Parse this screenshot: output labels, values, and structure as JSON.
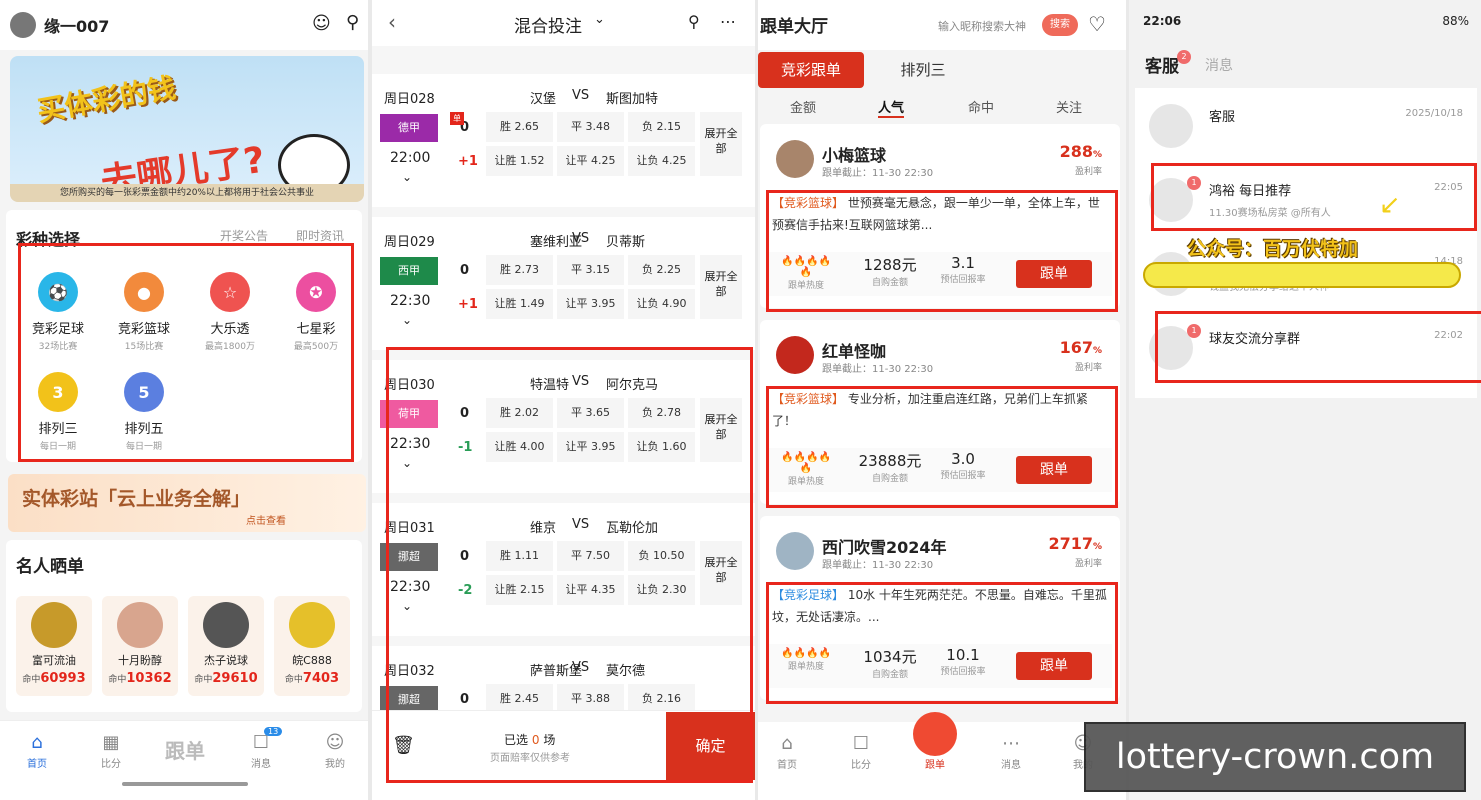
{
  "p1": {
    "username": "缘一007",
    "banner": {
      "line1": "买体彩的钱",
      "line2": "去哪儿了?",
      "footer": "您所购买的每一张彩票金额中约20%以上都将用于社会公共事业"
    },
    "section_title": "彩种选择",
    "links": [
      "开奖公告",
      "即时资讯"
    ],
    "lotteries": [
      {
        "name": "竞彩足球",
        "sub": "32场比赛",
        "icon": "soccer-icon",
        "color": "#29b6e8"
      },
      {
        "name": "竞彩篮球",
        "sub": "15场比赛",
        "icon": "basketball-icon",
        "color": "#f28a3c"
      },
      {
        "name": "大乐透",
        "sub": "最高1800万",
        "icon": "star-icon",
        "color": "#ef5350"
      },
      {
        "name": "七星彩",
        "sub": "最高500万",
        "icon": "seven-star-icon",
        "color": "#ec4fa0"
      },
      {
        "name": "排列三",
        "sub": "每日一期",
        "icon": "three-icon",
        "color": "#f2c21a"
      },
      {
        "name": "排列五",
        "sub": "每日一期",
        "icon": "five-icon",
        "color": "#5b7fe0"
      }
    ],
    "promo": {
      "title": "实体彩站「云上业务全解」",
      "link": "点击查看"
    },
    "famous_title": "名人晒单",
    "famous": [
      {
        "name": "富可流油",
        "hit_label": "命中",
        "hit": "60993"
      },
      {
        "name": "十月盼醇",
        "hit_label": "命中",
        "hit": "10362"
      },
      {
        "name": "杰子说球",
        "hit_label": "命中",
        "hit": "29610"
      },
      {
        "name": "皖C888",
        "hit_label": "命中",
        "hit": "7403"
      }
    ],
    "tabs": [
      {
        "label": "首页",
        "icon": "home-icon"
      },
      {
        "label": "比分",
        "icon": "score-icon"
      },
      {
        "label": "跟单",
        "icon": "follow-icon"
      },
      {
        "label": "消息",
        "icon": "message-icon",
        "badge": "13"
      },
      {
        "label": "我的",
        "icon": "profile-icon"
      }
    ]
  },
  "p2": {
    "title": "混合投注",
    "matches": [
      {
        "day": "周日028",
        "home": "汉堡",
        "vs": "VS",
        "away": "斯图加特",
        "league": "德甲",
        "league_color": "#9b2aa8",
        "time": "22:00",
        "h0": "0",
        "h1": "+1",
        "row1": [
          "胜 2.65",
          "平 3.48",
          "负 2.15"
        ],
        "row2": [
          "让胜 1.52",
          "让平 4.25",
          "让负 4.25"
        ],
        "single": "单"
      },
      {
        "day": "周日029",
        "home": "塞维利亚",
        "vs": "VS",
        "away": "贝蒂斯",
        "league": "西甲",
        "league_color": "#1e8a4a",
        "time": "22:30",
        "h0": "0",
        "h1": "+1",
        "row1": [
          "胜 2.73",
          "平 3.15",
          "负 2.25"
        ],
        "row2": [
          "让胜 1.49",
          "让平 3.95",
          "让负 4.90"
        ]
      },
      {
        "day": "周日030",
        "home": "特温特",
        "vs": "VS",
        "away": "阿尔克马",
        "league": "荷甲",
        "league_color": "#ef5aa0",
        "time": "22:30",
        "h0": "0",
        "h1": "-1",
        "row1": [
          "胜 2.02",
          "平 3.65",
          "负 2.78"
        ],
        "row2": [
          "让胜 4.00",
          "让平 3.95",
          "让负 1.60"
        ]
      },
      {
        "day": "周日031",
        "home": "维京",
        "vs": "VS",
        "away": "瓦勒伦加",
        "league": "挪超",
        "league_color": "#666666",
        "time": "22:30",
        "h0": "0",
        "h1": "-2",
        "row1": [
          "胜 1.11",
          "平 7.50",
          "负 10.50"
        ],
        "row2": [
          "让胜 2.15",
          "让平 4.35",
          "让负 2.30"
        ]
      },
      {
        "day": "周日032",
        "home": "萨普斯堡",
        "vs": "VS",
        "away": "莫尔德",
        "league": "挪超",
        "league_color": "#666666",
        "time": "",
        "h0": "0",
        "h1": "",
        "row1": [
          "胜 2.45",
          "平 3.88",
          "负 2.16"
        ],
        "row2": [
          "",
          "",
          ""
        ]
      }
    ],
    "expand": "展开全部",
    "footer": {
      "selected_prefix": "已选",
      "selected_count": "0",
      "selected_suffix": "场",
      "note": "页面赔率仅供参考",
      "confirm": "确定"
    }
  },
  "p3": {
    "title": "跟单大厅",
    "search_placeholder": "输入昵称搜索大神",
    "search_btn": "搜索",
    "tabs": [
      "竞彩跟单",
      "排列三"
    ],
    "subtabs": [
      "金额",
      "人气",
      "命中",
      "关注"
    ],
    "cards": [
      {
        "name": "小梅篮球",
        "deadline": "跟单截止：11-30 22:30",
        "rate": "288",
        "rate_unit": "%",
        "rate_label": "盈利率",
        "tag": "【竞彩篮球】",
        "tag_color": "orange",
        "text": "世预赛毫无悬念，跟一单少一单，全体上车，世预赛信手拈来!互联网篮球第...",
        "heat": "🔥🔥🔥🔥🔥",
        "heat_label": "跟单热度",
        "amount": "1288元",
        "amount_label": "自购金额",
        "ret": "3.1",
        "ret_label": "预估回报率",
        "btn": "跟单",
        "avatar_color": "#a8856b"
      },
      {
        "name": "红单怪咖",
        "deadline": "跟单截止：11-30 22:30",
        "rate": "167",
        "rate_unit": "%",
        "rate_label": "盈利率",
        "tag": "【竞彩篮球】",
        "tag_color": "orange",
        "text": "专业分析，加注重启连红路，兄弟们上车抓紧了！",
        "heat": "🔥🔥🔥🔥🔥",
        "heat_label": "跟单热度",
        "amount": "23888元",
        "amount_label": "自购金额",
        "ret": "3.0",
        "ret_label": "预估回报率",
        "btn": "跟单",
        "avatar_color": "#c3281d"
      },
      {
        "name": "西门吹雪2024年",
        "deadline": "跟单截止：11-30 22:30",
        "rate": "2717",
        "rate_unit": "%",
        "rate_label": "盈利率",
        "tag": "【竞彩足球】",
        "tag_color": "blue",
        "text": "10水 十年生死两茫茫。不思量。自难忘。千里孤坟，无处话凄凉。...",
        "heat": "🔥🔥🔥🔥",
        "heat_label": "跟单热度",
        "amount": "1034元",
        "amount_label": "自购金额",
        "ret": "10.1",
        "ret_label": "预估回报率",
        "btn": "跟单",
        "avatar_color": "#9fb4c4"
      }
    ],
    "tabbar": [
      "首页",
      "比分",
      "跟单",
      "消息",
      "我的"
    ]
  },
  "p4": {
    "time": "22:06",
    "status_right": "88%",
    "tabs": [
      "客服",
      "消息"
    ],
    "tab_badge": "2",
    "chats": [
      {
        "name": "客服",
        "time": "2025/10/18",
        "sub": "",
        "badge": ""
      },
      {
        "name": "鸿裕 每日推荐",
        "time": "22:05",
        "sub": "11.30赛场私房菜 @所有人",
        "badge": "1"
      },
      {
        "name": "",
        "time": "14:18",
        "sub": "钱盈我无偿分享给这个人神",
        "badge": ""
      },
      {
        "name": "球友交流分享群",
        "time": "22:02",
        "sub": "",
        "badge": "1"
      }
    ],
    "overlay": "公众号：百万伏特加"
  },
  "watermark": "lottery-crown.com"
}
